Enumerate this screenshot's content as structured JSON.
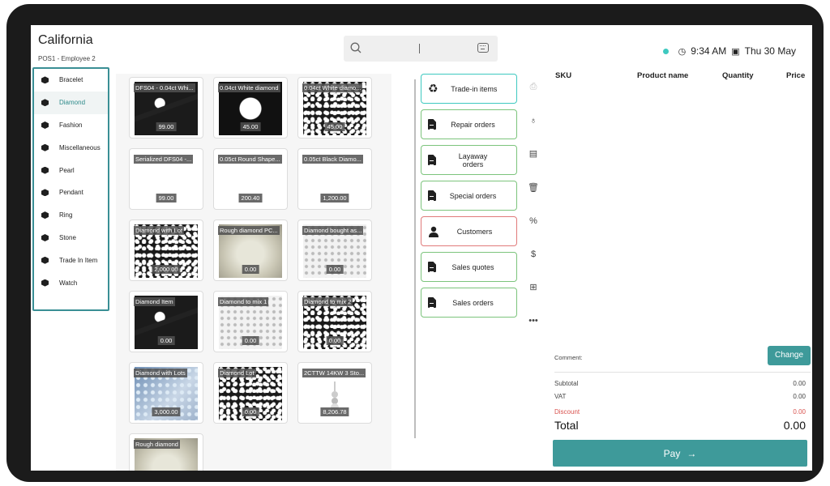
{
  "header": {
    "store": "California",
    "subtitle": "POS1 - Employee 2",
    "time": "9:34 AM",
    "date": "Thu 30 May"
  },
  "categories": [
    {
      "label": "Bracelet",
      "active": false
    },
    {
      "label": "Diamond",
      "active": true
    },
    {
      "label": "Fashion",
      "active": false
    },
    {
      "label": "Miscellaneous",
      "active": false
    },
    {
      "label": "Pearl",
      "active": false
    },
    {
      "label": "Pendant",
      "active": false
    },
    {
      "label": "Ring",
      "active": false
    },
    {
      "label": "Stone",
      "active": false
    },
    {
      "label": "Trade In Item",
      "active": false
    },
    {
      "label": "Watch",
      "active": false
    }
  ],
  "products": [
    {
      "name": "DFS04 - 0.04ct  Whi...",
      "price": "99.00"
    },
    {
      "name": "0.04ct White diamond",
      "price": "45.00"
    },
    {
      "name": "0.04ct White diamo...",
      "price": "45.00"
    },
    {
      "name": "Serialized DFS04 -...",
      "price": "99.00"
    },
    {
      "name": "0.05ct Round Shape...",
      "price": "200.40"
    },
    {
      "name": "0.05ct Black Diamo...",
      "price": "1,200.00"
    },
    {
      "name": "Diamond with Lot",
      "price": "2,000.00"
    },
    {
      "name": "Rough diamond PC...",
      "price": "0.00"
    },
    {
      "name": "Diamond bought as...",
      "price": "0.00"
    },
    {
      "name": "Diamond Item",
      "price": "0.00"
    },
    {
      "name": "Diamond to mix 1",
      "price": "0.00"
    },
    {
      "name": "Diamond to mix 2",
      "price": "0.00"
    },
    {
      "name": "Diamond with Lots",
      "price": "3,000.00"
    },
    {
      "name": "Diamond Lot",
      "price": "0.00"
    },
    {
      "name": "2CTTW 14KW 3 Sto...",
      "price": "8,206.78"
    },
    {
      "name": "Rough diamond",
      "price": ""
    }
  ],
  "orders": [
    {
      "label": "Trade-in items",
      "icon": "recycle-icon",
      "border": "#3ec9c0"
    },
    {
      "label": "Repair orders",
      "icon": "document-icon",
      "border": "#7cc47c"
    },
    {
      "label": "Layaway orders",
      "icon": "document-icon",
      "border": "#7cc47c"
    },
    {
      "label": "Special orders",
      "icon": "document-icon",
      "border": "#7cc47c"
    },
    {
      "label": "Customers",
      "icon": "user-icon",
      "border": "#e07a7a"
    },
    {
      "label": "Sales quotes",
      "icon": "quote-document-icon",
      "border": "#7cc47c"
    },
    {
      "label": "Sales orders",
      "icon": "document-icon",
      "border": "#7cc47c"
    }
  ],
  "receipt": {
    "columns": {
      "sku": "SKU",
      "name": "Product name",
      "qty": "Quantity",
      "price": "Price"
    },
    "comment_label": "Comment:",
    "change_label": "Change",
    "subtotal_label": "Subtotal",
    "subtotal": "0.00",
    "vat_label": "VAT",
    "vat": "0.00",
    "discount_label": "Discount",
    "discount": "0.00",
    "total_label": "Total",
    "total": "0.00",
    "pay_label": "Pay"
  },
  "colors": {
    "accent": "#3e9a9a",
    "sidebar_border": "#3a8f95",
    "online_dot": "#3ec9c0",
    "discount": "#d9534f"
  }
}
